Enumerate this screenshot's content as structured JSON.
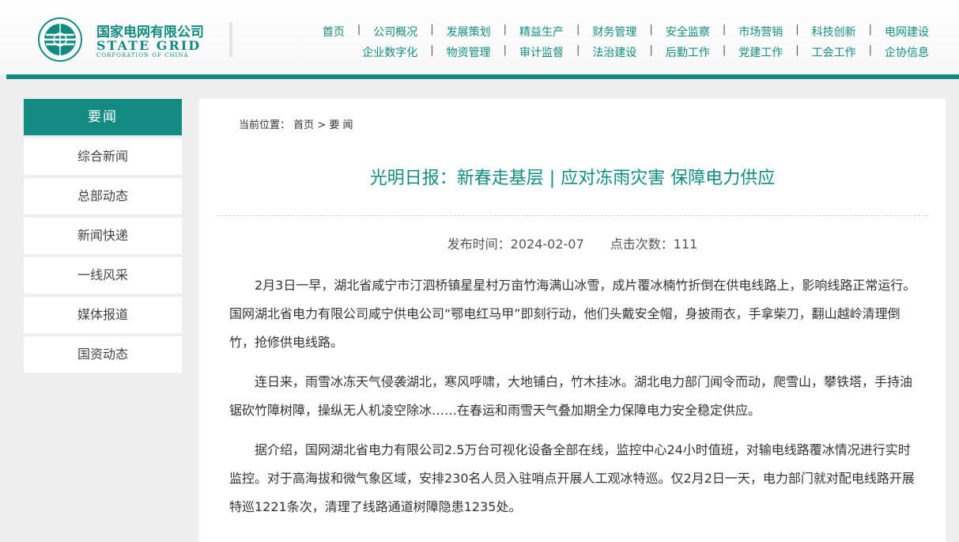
{
  "logo": {
    "name_cn": "国家电网有限公司",
    "name_en": "STATE GRID",
    "subtitle_en": "CORPORATION OF CHINA",
    "brand_color": "#138b82",
    "icon": "state-grid-globe-logo"
  },
  "nav": {
    "row1": [
      "首页",
      "公司概况",
      "发展策划",
      "精益生产",
      "财务管理",
      "安全监察",
      "市场营销",
      "科技创新",
      "电网建设"
    ],
    "row2": [
      "企业数字化",
      "物资管理",
      "审计监督",
      "法治建设",
      "后勤工作",
      "党建工作",
      "工会工作",
      "企协信息"
    ],
    "separator": "|"
  },
  "sidebar": {
    "heading": "要闻",
    "items": [
      "综合新闻",
      "总部动态",
      "新闻快递",
      "一线风采",
      "媒体报道",
      "国资动态"
    ]
  },
  "breadcrumb": {
    "label": "当前位置：",
    "home": "首页",
    "arrow": ">",
    "current": "要 闻"
  },
  "article": {
    "title": "光明日报：新春走基层 | 应对冻雨灾害 保障电力供应",
    "publish_label": "发布时间：2024-02-07",
    "clicks_label": "点击次数：111",
    "paragraphs": [
      "2月3日一早，湖北省咸宁市汀泗桥镇星星村万亩竹海满山冰雪，成片覆冰楠竹折倒在供电线路上，影响线路正常运行。国网湖北省电力有限公司咸宁供电公司“鄂电红马甲”即刻行动，他们头戴安全帽，身披雨衣，手拿柴刀，翻山越岭清理倒竹，抢修供电线路。",
      "连日来，雨雪冰冻天气侵袭湖北，寒风呼啸，大地铺白，竹木挂冰。湖北电力部门闻令而动，爬雪山，攀铁塔，手持油锯砍竹障树障，操纵无人机凌空除冰……在春运和雨雪天气叠加期全力保障电力安全稳定供应。",
      "据介绍，国网湖北省电力有限公司2.5万台可视化设备全部在线，监控中心24小时值班，对输电线路覆冰情况进行实时监控。对于高海拔和微气象区域，安排230名人员入驻哨点开展人工观冰特巡。仅2月2日一天，电力部门就对配电线路开展特巡1221条次，清理了线路通道树障隐患1235处。"
    ]
  }
}
